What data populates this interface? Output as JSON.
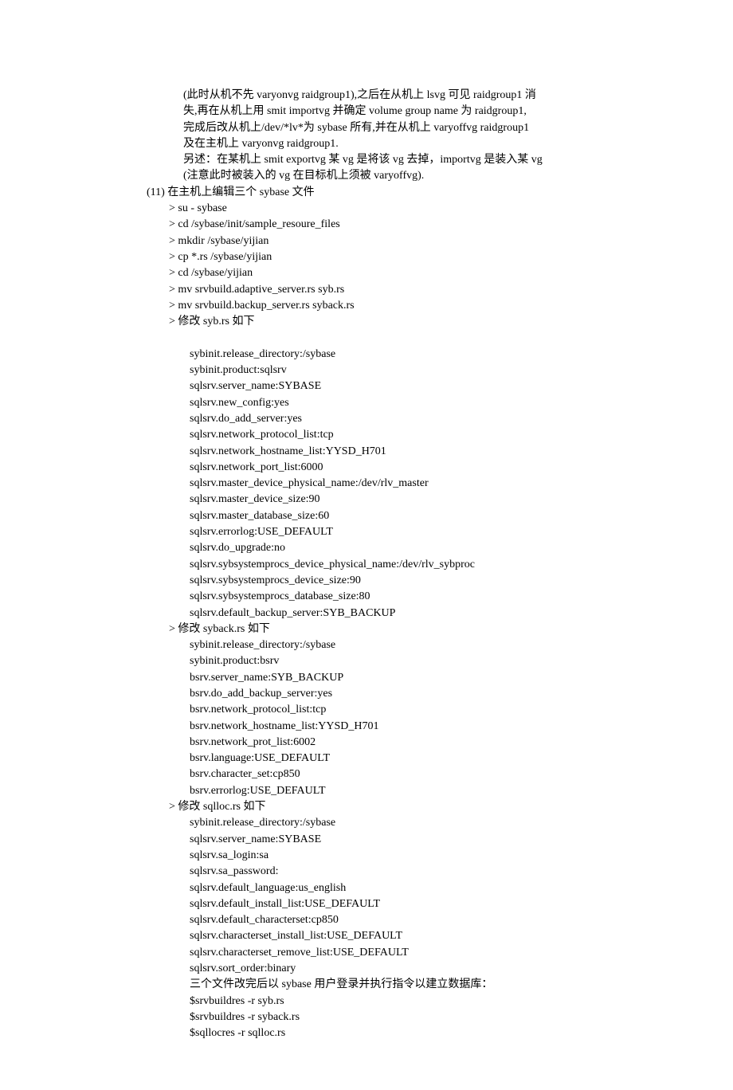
{
  "lines": [
    {
      "cls": "indent-a",
      "text": "(此时从机不先 varyonvg raidgroup1),之后在从机上 lsvg 可见 raidgroup1 消"
    },
    {
      "cls": "indent-a",
      "text": "失,再在从机上用 smit importvg 并确定 volume group name 为 raidgroup1,"
    },
    {
      "cls": "indent-a",
      "text": "完成后改从机上/dev/*lv*为 sybase 所有,并在从机上 varyoffvg raidgroup1"
    },
    {
      "cls": "indent-a",
      "text": "及在主机上 varyonvg raidgroup1."
    },
    {
      "cls": "indent-a",
      "text": "另述：在某机上 smit exportvg 某 vg 是将该 vg 去掉，importvg 是装入某 vg"
    },
    {
      "cls": "indent-a",
      "text": "(注意此时被装入的 vg 在目标机上须被 varyoffvg)."
    },
    {
      "cls": "indent-b",
      "text": "(11) 在主机上编辑三个 sybase 文件"
    },
    {
      "cls": "indent-c",
      "text": "> su - sybase"
    },
    {
      "cls": "indent-c",
      "text": "> cd /sybase/init/sample_resoure_files"
    },
    {
      "cls": "indent-c",
      "text": "> mkdir /sybase/yijian"
    },
    {
      "cls": "indent-c",
      "text": "> cp *.rs /sybase/yijian"
    },
    {
      "cls": "indent-c",
      "text": "> cd /sybase/yijian"
    },
    {
      "cls": "indent-c",
      "text": "> mv srvbuild.adaptive_server.rs syb.rs"
    },
    {
      "cls": "indent-c",
      "text": "> mv srvbuild.backup_server.rs syback.rs"
    },
    {
      "cls": "indent-c",
      "text": "> 修改 syb.rs 如下"
    },
    {
      "cls": "indent-d",
      "text": " "
    },
    {
      "cls": "indent-d",
      "text": "sybinit.release_directory:/sybase"
    },
    {
      "cls": "indent-d",
      "text": "sybinit.product:sqlsrv"
    },
    {
      "cls": "indent-d",
      "text": "sqlsrv.server_name:SYBASE"
    },
    {
      "cls": "indent-d",
      "text": "sqlsrv.new_config:yes"
    },
    {
      "cls": "indent-d",
      "text": "sqlsrv.do_add_server:yes"
    },
    {
      "cls": "indent-d",
      "text": "sqlsrv.network_protocol_list:tcp"
    },
    {
      "cls": "indent-d",
      "text": "sqlsrv.network_hostname_list:YYSD_H701"
    },
    {
      "cls": "indent-d",
      "text": "sqlsrv.network_port_list:6000"
    },
    {
      "cls": "indent-d",
      "text": "sqlsrv.master_device_physical_name:/dev/rlv_master"
    },
    {
      "cls": "indent-d",
      "text": "sqlsrv.master_device_size:90"
    },
    {
      "cls": "indent-d",
      "text": "sqlsrv.master_database_size:60"
    },
    {
      "cls": "indent-d",
      "text": "sqlsrv.errorlog:USE_DEFAULT"
    },
    {
      "cls": "indent-d",
      "text": "sqlsrv.do_upgrade:no"
    },
    {
      "cls": "indent-d",
      "text": "sqlsrv.sybsystemprocs_device_physical_name:/dev/rlv_sybproc"
    },
    {
      "cls": "indent-d",
      "text": "sqlsrv.sybsystemprocs_device_size:90"
    },
    {
      "cls": "indent-d",
      "text": "sqlsrv.sybsystemprocs_database_size:80"
    },
    {
      "cls": "indent-d",
      "text": "sqlsrv.default_backup_server:SYB_BACKUP"
    },
    {
      "cls": "indent-c",
      "text": "> 修改 syback.rs 如下"
    },
    {
      "cls": "indent-d",
      "text": "sybinit.release_directory:/sybase"
    },
    {
      "cls": "indent-d",
      "text": "sybinit.product:bsrv"
    },
    {
      "cls": "indent-d",
      "text": "bsrv.server_name:SYB_BACKUP"
    },
    {
      "cls": "indent-d",
      "text": "bsrv.do_add_backup_server:yes"
    },
    {
      "cls": "indent-d",
      "text": "bsrv.network_protocol_list:tcp"
    },
    {
      "cls": "indent-d",
      "text": "bsrv.network_hostname_list:YYSD_H701"
    },
    {
      "cls": "indent-d",
      "text": "bsrv.network_prot_list:6002"
    },
    {
      "cls": "indent-d",
      "text": "bsrv.language:USE_DEFAULT"
    },
    {
      "cls": "indent-d",
      "text": "bsrv.character_set:cp850"
    },
    {
      "cls": "indent-d",
      "text": "bsrv.errorlog:USE_DEFAULT"
    },
    {
      "cls": "indent-c",
      "text": "> 修改 sqlloc.rs 如下"
    },
    {
      "cls": "indent-d",
      "text": "sybinit.release_directory:/sybase"
    },
    {
      "cls": "indent-d",
      "text": "sqlsrv.server_name:SYBASE"
    },
    {
      "cls": "indent-d",
      "text": "sqlsrv.sa_login:sa"
    },
    {
      "cls": "indent-d",
      "text": "sqlsrv.sa_password:"
    },
    {
      "cls": "indent-d",
      "text": "sqlsrv.default_language:us_english"
    },
    {
      "cls": "indent-d",
      "text": "sqlsrv.default_install_list:USE_DEFAULT"
    },
    {
      "cls": "indent-d",
      "text": "sqlsrv.default_characterset:cp850"
    },
    {
      "cls": "indent-d",
      "text": "sqlsrv.characterset_install_list:USE_DEFAULT"
    },
    {
      "cls": "indent-d",
      "text": "sqlsrv.characterset_remove_list:USE_DEFAULT"
    },
    {
      "cls": "indent-d",
      "text": "sqlsrv.sort_order:binary"
    },
    {
      "cls": "indent-d",
      "text": "三个文件改完后以 sybase 用户登录并执行指令以建立数据库："
    },
    {
      "cls": "indent-d",
      "text": "$srvbuildres -r syb.rs"
    },
    {
      "cls": "indent-d",
      "text": "$srvbuildres -r syback.rs"
    },
    {
      "cls": "indent-d",
      "text": "$sqllocres -r sqlloc.rs"
    }
  ]
}
